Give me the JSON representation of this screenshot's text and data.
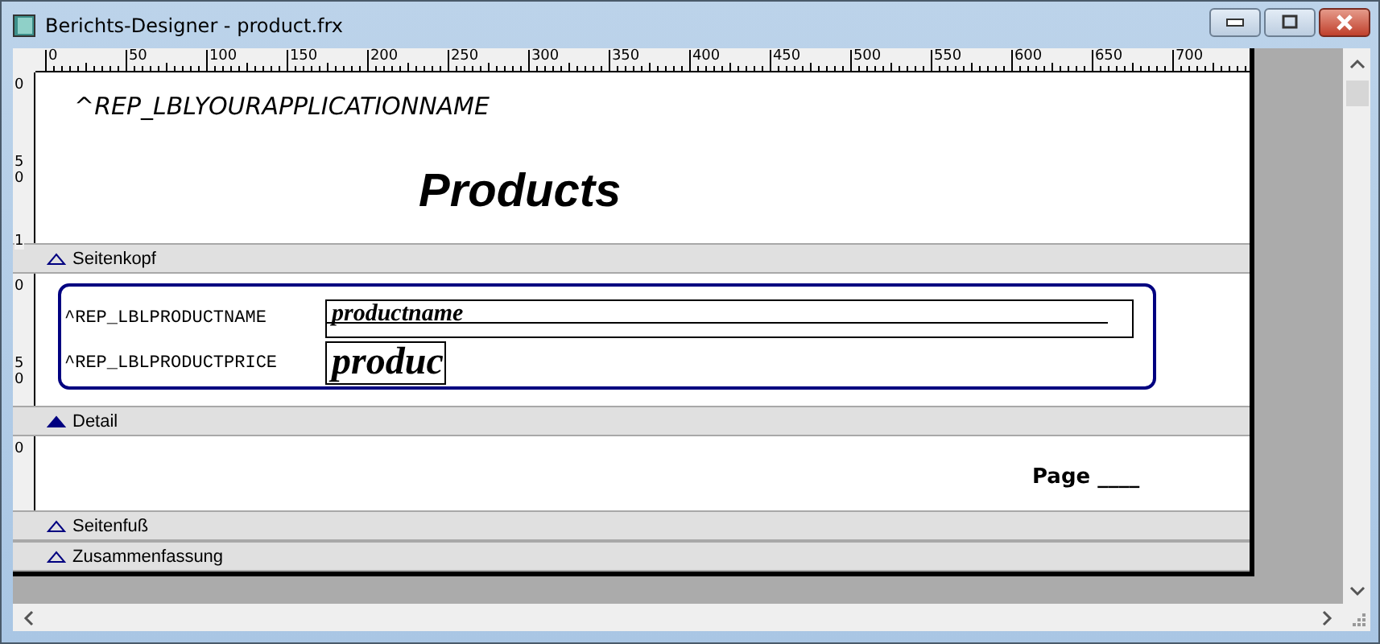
{
  "window": {
    "title": "Berichts-Designer - product.frx"
  },
  "ruler": {
    "labels": [
      "0",
      "50",
      "100",
      "150",
      "200",
      "250",
      "300",
      "350",
      "400",
      "450",
      "500",
      "550",
      "600",
      "650",
      "700"
    ]
  },
  "bands": [
    {
      "kind": "header",
      "name": "Seitenkopf",
      "selected": false,
      "ruler_labels": [
        "0",
        "50",
        "1"
      ],
      "app_name": "^REP_LBLYOURAPPLICATIONNAME",
      "title": "Products"
    },
    {
      "kind": "detail",
      "name": "Detail",
      "selected": true,
      "ruler_labels": [
        "0",
        "50"
      ],
      "rows": [
        {
          "label": "^REP_LBLPRODUCTNAME",
          "field": "productname"
        },
        {
          "label": "^REP_LBLPRODUCTPRICE",
          "field": "produc"
        }
      ]
    },
    {
      "kind": "footer",
      "name": "Seitenfuß",
      "selected": false,
      "ruler_labels": [
        "0"
      ],
      "page": "Page ____"
    },
    {
      "kind": "summary",
      "name": "Zusammenfassung",
      "selected": false
    }
  ]
}
